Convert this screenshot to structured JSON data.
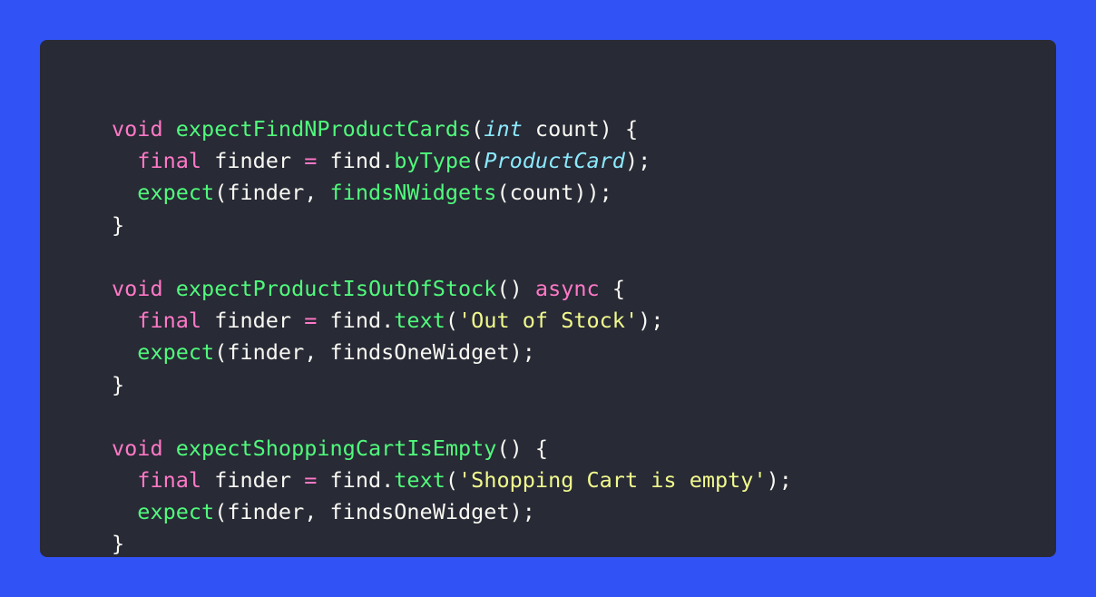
{
  "colors": {
    "background": "#3153f5",
    "editor": "#282a36",
    "keyword": "#ff79c6",
    "function": "#50fa7b",
    "type": "#8be9fd",
    "string": "#f1fa8c",
    "plain": "#f8f8f2"
  },
  "code": {
    "lines": [
      [
        {
          "t": "void",
          "c": "kw"
        },
        {
          "t": " ",
          "c": "pl"
        },
        {
          "t": "expectFindNProductCards",
          "c": "fn"
        },
        {
          "t": "(",
          "c": "pl"
        },
        {
          "t": "int",
          "c": "type"
        },
        {
          "t": " count) {",
          "c": "pl"
        }
      ],
      [
        {
          "t": "  ",
          "c": "pl"
        },
        {
          "t": "final",
          "c": "kw"
        },
        {
          "t": " finder ",
          "c": "pl"
        },
        {
          "t": "=",
          "c": "kw"
        },
        {
          "t": " find.",
          "c": "pl"
        },
        {
          "t": "byType",
          "c": "fn"
        },
        {
          "t": "(",
          "c": "pl"
        },
        {
          "t": "ProductCard",
          "c": "type"
        },
        {
          "t": ");",
          "c": "pl"
        }
      ],
      [
        {
          "t": "  ",
          "c": "pl"
        },
        {
          "t": "expect",
          "c": "fn"
        },
        {
          "t": "(finder, ",
          "c": "pl"
        },
        {
          "t": "findsNWidgets",
          "c": "fn"
        },
        {
          "t": "(count));",
          "c": "pl"
        }
      ],
      [
        {
          "t": "}",
          "c": "pl"
        }
      ],
      [],
      [
        {
          "t": "void",
          "c": "kw"
        },
        {
          "t": " ",
          "c": "pl"
        },
        {
          "t": "expectProductIsOutOfStock",
          "c": "fn"
        },
        {
          "t": "() ",
          "c": "pl"
        },
        {
          "t": "async",
          "c": "kw"
        },
        {
          "t": " {",
          "c": "pl"
        }
      ],
      [
        {
          "t": "  ",
          "c": "pl"
        },
        {
          "t": "final",
          "c": "kw"
        },
        {
          "t": " finder ",
          "c": "pl"
        },
        {
          "t": "=",
          "c": "kw"
        },
        {
          "t": " find.",
          "c": "pl"
        },
        {
          "t": "text",
          "c": "fn"
        },
        {
          "t": "(",
          "c": "pl"
        },
        {
          "t": "'Out of Stock'",
          "c": "str"
        },
        {
          "t": ");",
          "c": "pl"
        }
      ],
      [
        {
          "t": "  ",
          "c": "pl"
        },
        {
          "t": "expect",
          "c": "fn"
        },
        {
          "t": "(finder, findsOneWidget);",
          "c": "pl"
        }
      ],
      [
        {
          "t": "}",
          "c": "pl"
        }
      ],
      [],
      [
        {
          "t": "void",
          "c": "kw"
        },
        {
          "t": " ",
          "c": "pl"
        },
        {
          "t": "expectShoppingCartIsEmpty",
          "c": "fn"
        },
        {
          "t": "() {",
          "c": "pl"
        }
      ],
      [
        {
          "t": "  ",
          "c": "pl"
        },
        {
          "t": "final",
          "c": "kw"
        },
        {
          "t": " finder ",
          "c": "pl"
        },
        {
          "t": "=",
          "c": "kw"
        },
        {
          "t": " find.",
          "c": "pl"
        },
        {
          "t": "text",
          "c": "fn"
        },
        {
          "t": "(",
          "c": "pl"
        },
        {
          "t": "'Shopping Cart is empty'",
          "c": "str"
        },
        {
          "t": ");",
          "c": "pl"
        }
      ],
      [
        {
          "t": "  ",
          "c": "pl"
        },
        {
          "t": "expect",
          "c": "fn"
        },
        {
          "t": "(finder, findsOneWidget);",
          "c": "pl"
        }
      ],
      [
        {
          "t": "}",
          "c": "pl"
        }
      ]
    ]
  }
}
